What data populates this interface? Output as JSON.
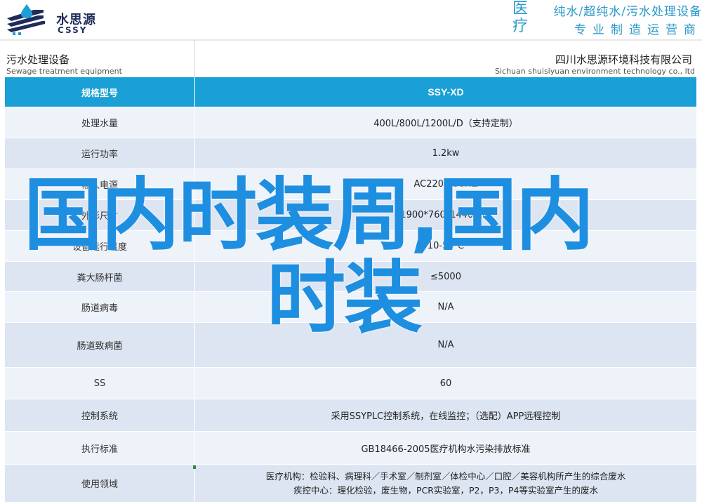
{
  "header": {
    "logo_cn": "水思源",
    "logo_en": "CSSY",
    "slogan_big": "医疗",
    "slogan_line1": "纯水/超纯水/污水处理设备",
    "slogan_line2": "专业制造运营商"
  },
  "subheader": {
    "left_cn": "污水处理设备",
    "left_en": "Sewage treatment equipment",
    "right_cn": "四川水思源环境科技有限公司",
    "right_en": "Sichuan shuisiyuan environment technology co., ltd"
  },
  "table": {
    "header": {
      "label": "规格型号",
      "value": "SSY-XD"
    },
    "rows": [
      {
        "label": "处理水量",
        "value": "400L/800L/1200L/D（支持定制）"
      },
      {
        "label": "运行功率",
        "value": "1.2kw"
      },
      {
        "label": "输入电源",
        "value": "AC220V/50HZ"
      },
      {
        "label": "外形尺寸",
        "value": "1900*760*1440mm"
      },
      {
        "label": "设备运行温度",
        "value": "10-50℃"
      },
      {
        "label": "粪大肠杆菌",
        "value": "≤5000"
      },
      {
        "label": "肠道病毒",
        "value": "N/A"
      },
      {
        "label": "肠道致病菌",
        "value": "N/A"
      },
      {
        "label": "SS",
        "value": "60"
      },
      {
        "label": "控制系统",
        "value": "采用SSYPLC控制系统，在线监控；（选配）APP远程控制"
      },
      {
        "label": "执行标准",
        "value": "GB18466-2005医疗机构水污染排放标准"
      },
      {
        "label": "使用领域",
        "line1": "医疗机构：检验科、病理科／手术室／制剂室／体检中心／口腔／美容机构所产生的综合废水",
        "line2": "疾控中心：理化检验，废生物，PCR实验室，P2，P3，P4等实验室产生的废水"
      }
    ]
  },
  "overlay": {
    "line1": "国内时装周,国内",
    "line2": "时装"
  },
  "colors": {
    "accent": "#1aa0d6",
    "row_light": "#eef2f9",
    "row_dark": "#dde5f2",
    "overlay": "#1e8fe0"
  }
}
